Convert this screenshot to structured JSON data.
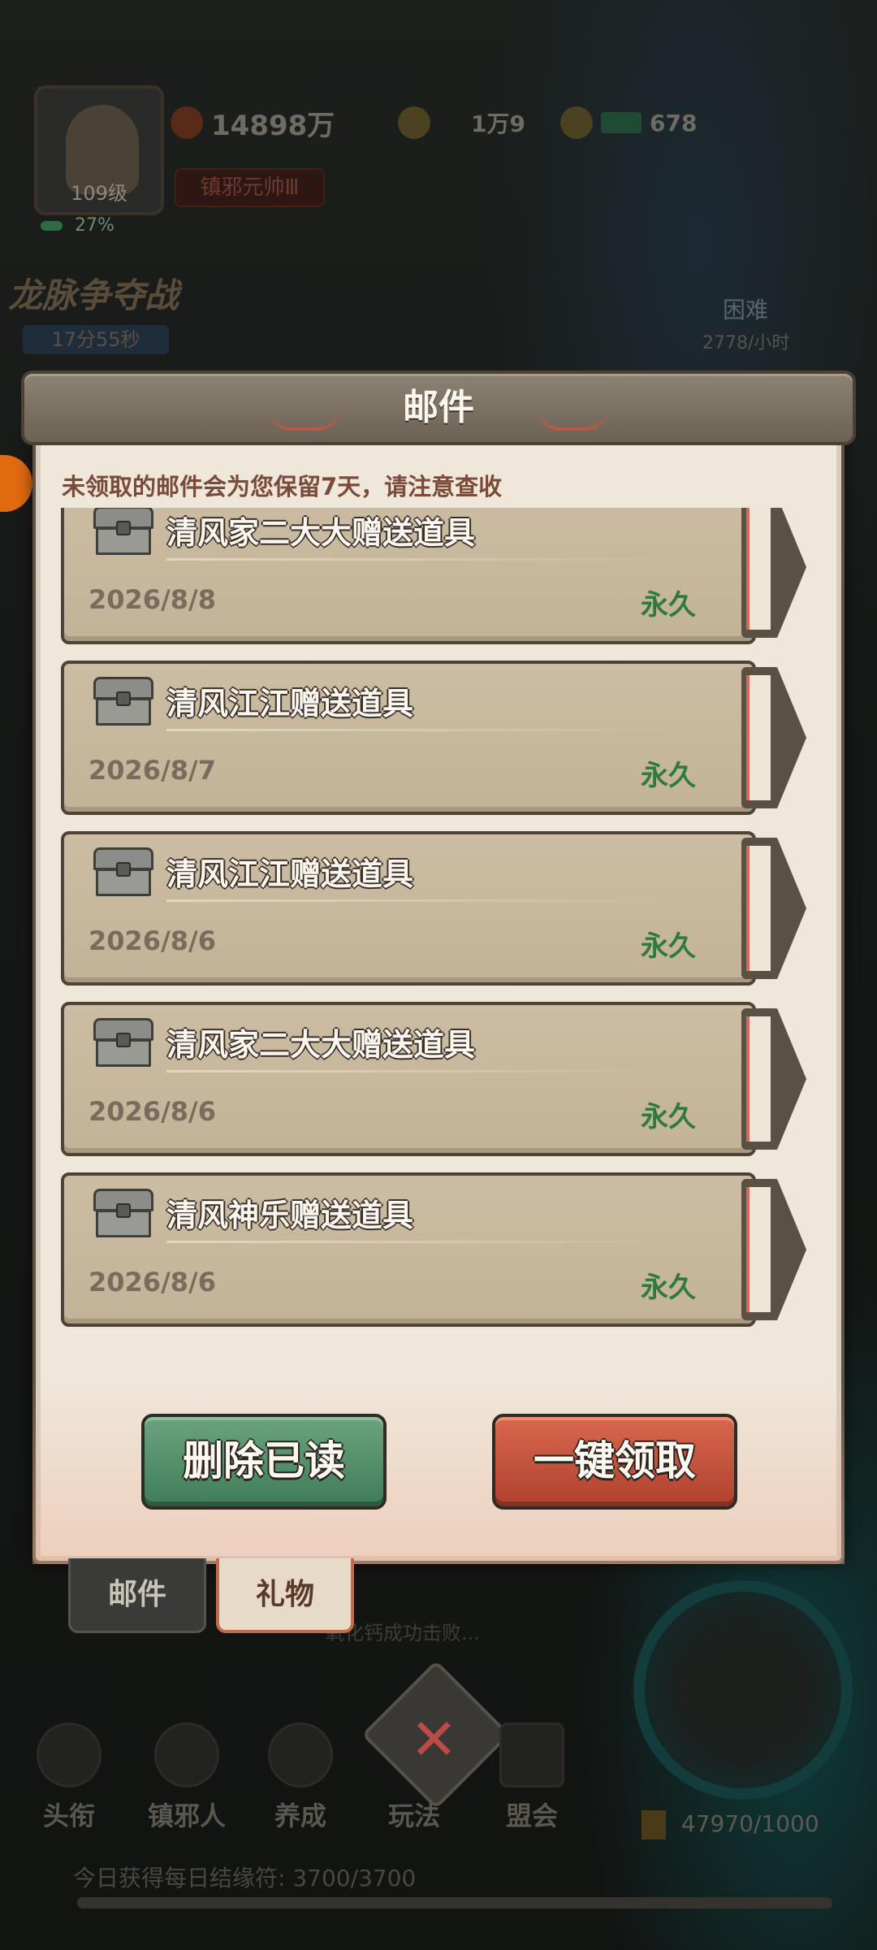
{
  "player": {
    "level": "109级",
    "exp_percent": "27%",
    "power": "14898万",
    "gold": "1万9",
    "gems": "678",
    "title": "镇邪元帅Ⅲ"
  },
  "event": {
    "name": "龙脉争夺战",
    "countdown": "17分55秒",
    "difficulty": "困难",
    "rate": "2778/小时"
  },
  "dialog": {
    "title": "邮件",
    "notice": "未领取的邮件会为您保留7天，请注意查收",
    "mails": [
      {
        "title": "清风家二大大赠送道具",
        "date": "2026/8/8",
        "expiry": "永久"
      },
      {
        "title": "清风江江赠送道具",
        "date": "2026/8/7",
        "expiry": "永久"
      },
      {
        "title": "清风江江赠送道具",
        "date": "2026/8/6",
        "expiry": "永久"
      },
      {
        "title": "清风家二大大赠送道具",
        "date": "2026/8/6",
        "expiry": "永久"
      },
      {
        "title": "清风神乐赠送道具",
        "date": "2026/8/6",
        "expiry": "永久"
      }
    ],
    "delete_read_label": "删除已读",
    "claim_all_label": "一键领取"
  },
  "tabs": {
    "mail": "邮件",
    "gift": "礼物"
  },
  "chat": {
    "message": "氧化钙成功击败..."
  },
  "nav": {
    "items": [
      "头衔",
      "镇邪人",
      "养成",
      "玩法",
      "盟会"
    ]
  },
  "currency": "47970/1000",
  "daily": {
    "label": "今日获得每日结缘符: 3700/3700",
    "progress": 1.0
  },
  "colors": {
    "green_button": "#3f7c58",
    "red_button": "#b0412e",
    "expiry_green": "#2f7a3f",
    "dialog_bg": "#efe7da"
  }
}
